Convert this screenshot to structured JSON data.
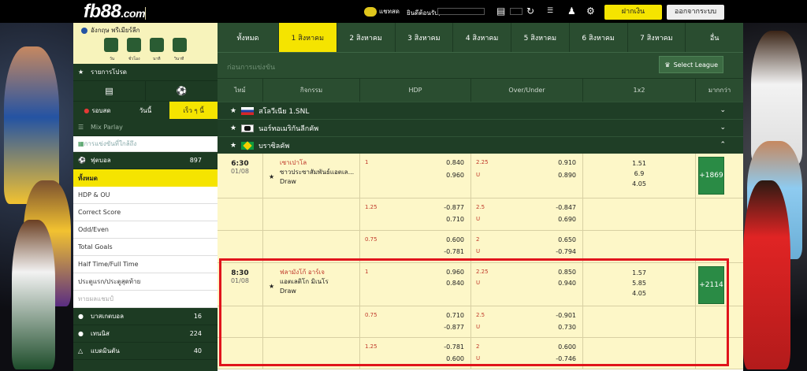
{
  "header": {
    "logo_main": "fb88",
    "logo_suffix": ".com",
    "chat_label": "แชทสด",
    "welcome_label": "ยินดีต้อนรับ,",
    "deposit_label": "ฝากเงิน",
    "logout_label": "ออกจากระบบ"
  },
  "sidebar": {
    "promo_league": "อังกฤษ พรีเมียร์ลีก",
    "countdown_labels": [
      "วัน",
      "ชั่วโมง",
      "นาที",
      "วินาที"
    ],
    "my_bets_label": "รายการโปรด",
    "tabs": [
      "รอบสด",
      "วันนี้",
      "เร็ว ๆ นี้"
    ],
    "mix_parlay": "Mix Parlay",
    "bet_in_running": "การแข่งขันที่ใกล้ถึง",
    "sports": [
      {
        "name": "ฟุตบอล",
        "count": "897"
      },
      {
        "name": "บาสเกตบอล",
        "count": "16"
      },
      {
        "name": "เทนนิส",
        "count": "224"
      },
      {
        "name": "แบดมินตัน",
        "count": "40"
      }
    ],
    "bet_types": [
      "ทั้งหมด",
      "HDP & OU",
      "Correct Score",
      "Odd/Even",
      "Total Goals",
      "Half Time/Full Time",
      "ประตูแรก/ประตูสุดท้าย",
      "ทายผลแชมป์"
    ]
  },
  "date_tabs": [
    "ทั้งหมด",
    "1 สิงหาคม",
    "2 สิงหาคม",
    "3 สิงหาคม",
    "4 สิงหาคม",
    "5 สิงหาคม",
    "6 สิงหาคม",
    "7 สิงหาคม",
    "อื่น"
  ],
  "filter": {
    "label": "ก่อนการแข่งขัน",
    "select_league": "Select League"
  },
  "columns": [
    "ไทม์",
    "กิจกรรม",
    "HDP",
    "Over/Under",
    "1x2",
    "มากกว่า"
  ],
  "leagues": [
    {
      "name": "สโลวีเนีย 1.SNL"
    },
    {
      "name": "นอร์ทอเมริกันลีกคัพ"
    },
    {
      "name": "บราซิลคัพ"
    }
  ],
  "matches": [
    {
      "time": "6:30",
      "date": "01/08",
      "home": "เซาเปาโล",
      "away": "ซาวประซาสัมพันธ์แอตเล...",
      "draw": "Draw",
      "x12": [
        "1.51",
        "6.9",
        "4.05"
      ],
      "more": "+1869",
      "lines": [
        {
          "hdp": "1",
          "hdp_o": [
            "0.840",
            "0.960"
          ],
          "ou": "2.25",
          "ou_u": "U",
          "ou_o": [
            "0.910",
            "0.890"
          ]
        },
        {
          "hdp": "1.25",
          "hdp_o": [
            "-0.877",
            "0.710"
          ],
          "ou": "2.5",
          "ou_u": "U",
          "ou_o": [
            "-0.847",
            "0.690"
          ]
        },
        {
          "hdp": "0.75",
          "hdp_o": [
            "0.600",
            "-0.781"
          ],
          "ou": "2",
          "ou_u": "U",
          "ou_o": [
            "0.650",
            "-0.794"
          ]
        }
      ]
    },
    {
      "time": "8:30",
      "date": "01/08",
      "home": "ฟลามังโก้ อาร์เจ",
      "away": "แอตเลติโก มิเนโร",
      "draw": "Draw",
      "x12": [
        "1.57",
        "5.85",
        "4.05"
      ],
      "more": "+2114",
      "lines": [
        {
          "hdp": "1",
          "hdp_o": [
            "0.960",
            "0.840"
          ],
          "ou": "2.25",
          "ou_u": "U",
          "ou_o": [
            "0.850",
            "0.940"
          ]
        },
        {
          "hdp": "0.75",
          "hdp_o": [
            "0.710",
            "-0.877"
          ],
          "ou": "2.5",
          "ou_u": "U",
          "ou_o": [
            "-0.901",
            "0.730"
          ]
        },
        {
          "hdp": "1.25",
          "hdp_o": [
            "-0.781",
            "0.600"
          ],
          "ou": "2",
          "ou_u": "U",
          "ou_o": [
            "0.600",
            "-0.746"
          ]
        }
      ]
    }
  ]
}
